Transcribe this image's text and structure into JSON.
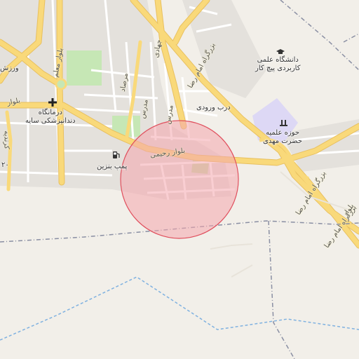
{
  "map": {
    "labels": {
      "university": "دانشگاه علمی\nکاربردی پیچ کار",
      "seminary": "حوزه علمیه\nحضرت مهدی",
      "clinic": "درمانگاه\nدندانپزشکی سایه",
      "gas_station": "پمپ بنزین",
      "entrance": "درب ورودی",
      "partial_top_left": "ورزش",
      "partial_left_digit": "۲۰"
    },
    "roads": {
      "rahimi_blvd": "بلوار رحیمی",
      "imam_reza_expressway_1": "بزرگراه امام رضا",
      "imam_reza_expressway_2": "بزرگراه امام رضا",
      "imam_reza_expressway_3": "بزرگراه امام رضا",
      "moallem_blvd": "بلوار معلم",
      "blvd_left": "بلوار",
      "karimi_st": "کرندیه",
      "jahadi": "جهادی",
      "mosafa": "مرصاد",
      "modarres_1": "مدرس",
      "modarres_2": "مدرس",
      "vali": "بلوار"
    },
    "icons": {
      "university": "graduation-cap-icon",
      "seminary": "mosque-icon",
      "clinic": "hospital-cross-icon",
      "gas_station": "fuel-pump-icon"
    },
    "colors": {
      "background": "#f2efe9",
      "major_road": "#f9d97a",
      "minor_road": "#ffffff",
      "park": "#c6e7b5",
      "institution": "#ddd8f5",
      "circle_fill": "#f4a6ad",
      "circle_stroke": "#e0505e",
      "boundary": "#8a8fa3",
      "waterway": "#7fb1e0"
    }
  }
}
